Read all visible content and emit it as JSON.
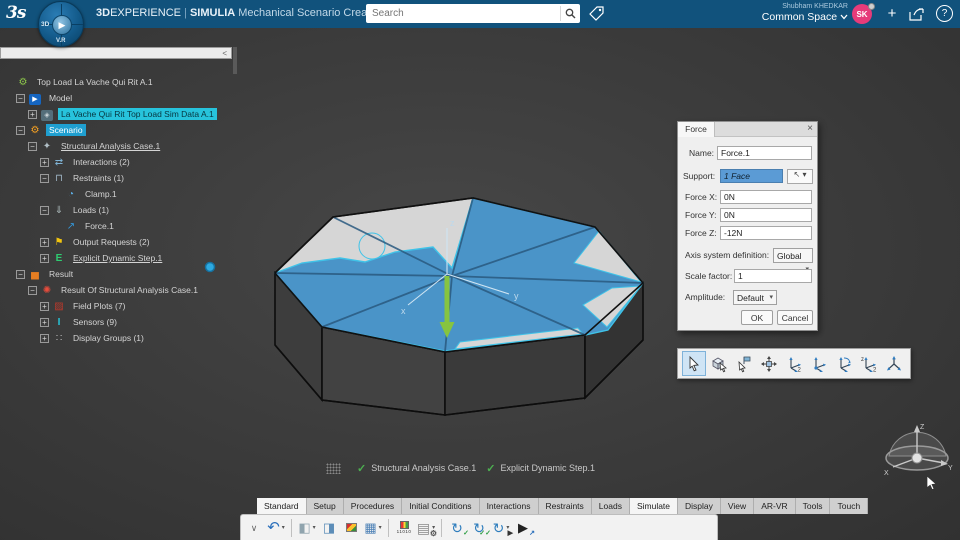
{
  "topbar": {
    "brand_bold": "3D",
    "brand_rest": "EXPERIENCE",
    "separator": "|",
    "app": "SIMULIA",
    "module": "Mechanical Scenario Creation",
    "search_placeholder": "Search",
    "user_name": "Shubham KHEDKAR",
    "space_label": "Common Space",
    "space_caret": "v",
    "avatar_initials": "SK",
    "plus_label": "+",
    "help_label": "?"
  },
  "compass": {
    "hub": "3D",
    "vr": "V.R"
  },
  "tree_scrollbar": {
    "collapse_glyph": "<"
  },
  "tree": {
    "items": [
      {
        "label": "Top Load La Vache Qui Rit A.1",
        "level": 0,
        "icon": "gear-green-icon",
        "expander": null
      },
      {
        "label": "Model",
        "level": 1,
        "icon": "model-icon",
        "expander": "minus"
      },
      {
        "label": "La Vache Qui Rit Top Load Sim Data A.1",
        "level": 2,
        "icon": "simdata-icon",
        "expander": "plus",
        "highlight": true
      },
      {
        "label": "Scenario",
        "level": 1,
        "icon": "gear-orange-icon",
        "expander": "minus",
        "selected": true
      },
      {
        "label": "Structural Analysis Case.1",
        "level": 2,
        "icon": "analysis-case-icon",
        "expander": "minus",
        "underline": true
      },
      {
        "label": "Interactions (2)",
        "level": 3,
        "icon": "interactions-icon",
        "expander": "plus"
      },
      {
        "label": "Restraints (1)",
        "level": 3,
        "icon": "restraints-icon",
        "expander": "minus"
      },
      {
        "label": "Clamp.1",
        "level": 4,
        "icon": "clamp-icon",
        "expander": null
      },
      {
        "label": "Loads (1)",
        "level": 3,
        "icon": "loads-icon",
        "expander": "minus"
      },
      {
        "label": "Force.1",
        "level": 4,
        "icon": "force-icon",
        "expander": null
      },
      {
        "label": "Output Requests (2)",
        "level": 3,
        "icon": "output-requests-icon",
        "expander": "plus"
      },
      {
        "label": "Explicit Dynamic Step.1",
        "level": 3,
        "icon": "explicit-step-icon",
        "expander": "plus",
        "underline": true
      },
      {
        "label": "Result",
        "level": 1,
        "icon": "result-icon",
        "expander": "minus"
      },
      {
        "label": "Result Of Structural Analysis Case.1",
        "level": 2,
        "icon": "result-case-icon",
        "expander": "minus"
      },
      {
        "label": "Field Plots (7)",
        "level": 3,
        "icon": "field-plots-icon",
        "expander": "plus"
      },
      {
        "label": "Sensors (9)",
        "level": 3,
        "icon": "sensors-icon",
        "expander": "plus"
      },
      {
        "label": "Display Groups (1)",
        "level": 3,
        "icon": "display-groups-icon",
        "expander": "plus"
      }
    ]
  },
  "viewport": {
    "axis_labels": {
      "x": "x",
      "y": "y",
      "z": "z"
    },
    "nav_compass_labels": {
      "x": "X",
      "y": "Y",
      "z": "Z"
    }
  },
  "status": {
    "items": [
      "Structural Analysis Case.1",
      "Explicit Dynamic Step.1"
    ]
  },
  "dialog": {
    "title": "Force",
    "close_glyph": "×",
    "name_label": "Name:",
    "name_value": "Force.1",
    "support_label": "Support:",
    "support_value": "1 Face",
    "fx_label": "Force X:",
    "fx_value": "0N",
    "fy_label": "Force Y:",
    "fy_value": "0N",
    "fz_label": "Force Z:",
    "fz_value": "-12N",
    "axis_label": "Axis system definition:",
    "axis_value": "Global",
    "scale_label": "Scale factor:",
    "scale_value": "1",
    "amplitude_label": "Amplitude:",
    "amplitude_value": "Default",
    "ok_label": "OK",
    "cancel_label": "Cancel"
  },
  "manip_toolbar": {
    "tools": [
      {
        "name": "select-tool",
        "icon": "cursor-icon",
        "active": true
      },
      {
        "name": "select-geometry-tool",
        "icon": "cube-cursor-icon",
        "active": false
      },
      {
        "name": "probe-tool",
        "icon": "flag-cursor-icon",
        "active": false
      },
      {
        "name": "pan-manipulator-tool",
        "icon": "move-cross-icon",
        "active": false
      },
      {
        "name": "translate-axes-tool",
        "icon": "triad-2-icon",
        "active": false
      },
      {
        "name": "move-axes-tool",
        "icon": "triad-dot-icon",
        "active": false
      },
      {
        "name": "rotate-axes-tool",
        "icon": "triad-rotate-icon",
        "active": false
      },
      {
        "name": "axes-two-direction-tool",
        "icon": "triad-z2-icon",
        "active": false
      },
      {
        "name": "free-rotation-tool",
        "icon": "axis-star-icon",
        "active": false
      }
    ]
  },
  "tabs": {
    "items": [
      {
        "label": "Standard",
        "active": true
      },
      {
        "label": "Setup",
        "active": false
      },
      {
        "label": "Procedures",
        "active": false
      },
      {
        "label": "Initial Conditions",
        "active": false
      },
      {
        "label": "Interactions",
        "active": false
      },
      {
        "label": "Restraints",
        "active": false
      },
      {
        "label": "Loads",
        "active": false
      },
      {
        "label": "Simulate",
        "active": true
      },
      {
        "label": "Display",
        "active": false
      },
      {
        "label": "View",
        "active": false
      },
      {
        "label": "AR-VR",
        "active": false
      },
      {
        "label": "Tools",
        "active": false
      },
      {
        "label": "Touch",
        "active": false
      }
    ]
  },
  "bottom_toolbar": {
    "buttons": [
      {
        "name": "expand-panel-button",
        "icon": "chevron-down-icon"
      },
      {
        "name": "undo-button",
        "icon": "undo-icon",
        "caret": true
      },
      {
        "name": "sep"
      },
      {
        "name": "part-button",
        "icon": "part-icon",
        "caret": true
      },
      {
        "name": "import-model-button",
        "icon": "part-blue-icon"
      },
      {
        "name": "results-layers-button",
        "icon": "layers-icon"
      },
      {
        "name": "table-view-button",
        "icon": "table-icon",
        "caret": true
      },
      {
        "name": "sep"
      },
      {
        "name": "output-data-button",
        "icon": "binary-icon",
        "caption": "11010"
      },
      {
        "name": "database-button",
        "icon": "database-gear-icon",
        "caret": true
      },
      {
        "name": "sep"
      },
      {
        "name": "update-button",
        "icon": "refresh-check-icon"
      },
      {
        "name": "validate-button",
        "icon": "refresh-doublecheck-icon"
      },
      {
        "name": "run-options-button",
        "icon": "refresh-play-icon",
        "caret": true
      },
      {
        "name": "simulate-run-button",
        "icon": "play-export-icon"
      }
    ]
  },
  "colors": {
    "topbar": "#11527c",
    "highlight_cyan": "#27c3dc",
    "support_blue": "#5b9bd5",
    "face_blue": "#4a94c8",
    "face_edge": "#2a5a80",
    "rim_cyan": "#3fc3e8",
    "arrow_green": "#86c440",
    "check_green": "#4caf50",
    "avatar_pink": "#e63b7a"
  }
}
